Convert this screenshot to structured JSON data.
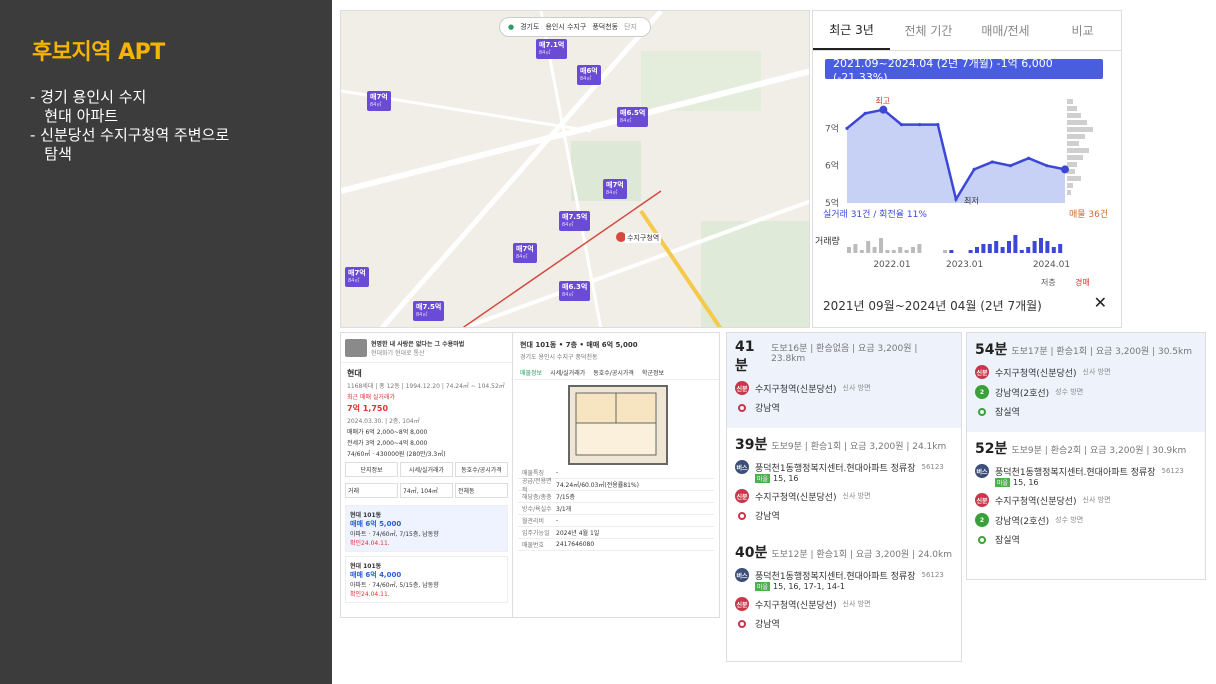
{
  "left": {
    "title": "후보지역 APT",
    "bullets": [
      "- 경기 용인시 수지\n   현대 아파트",
      "- 신분당선 수지구청역 주변으로\n   탐색"
    ]
  },
  "map": {
    "search": {
      "region": "경기도",
      "district": "용인시 수지구",
      "dong": "풍덕천동",
      "unit": "단지"
    },
    "pins": [
      {
        "price": "매7.1억",
        "sub": "84㎡"
      },
      {
        "price": "매6억",
        "sub": "84㎡"
      },
      {
        "price": "매7억",
        "sub": "84㎡"
      },
      {
        "price": "매6.5억",
        "sub": "84㎡"
      },
      {
        "price": "매7억",
        "sub": "84㎡"
      },
      {
        "price": "매7.5억",
        "sub": "84㎡"
      },
      {
        "price": "매7억",
        "sub": "84㎡"
      },
      {
        "price": "매6.3억",
        "sub": "84㎡"
      },
      {
        "price": "매7억",
        "sub": "84㎡"
      },
      {
        "price": "매7.5억",
        "sub": "84㎡"
      }
    ],
    "station_label": "수지구청역"
  },
  "chart": {
    "tabs": [
      "최근 3년",
      "전체 기간",
      "매매/전세",
      "비교"
    ],
    "banner": "2021.09~2024.04 (2년 7개월) -1억 6,000 (-21.33%)",
    "legend_trade": "실거래 31건 / 회전율 11%",
    "listing_count": "매물 36건",
    "volume_label": "거래량",
    "high_label": "최고",
    "low_label": "최저",
    "legend_low": "저층",
    "legend_auction": "경매",
    "range": "2021년 09월~2024년 04월 (2년 7개월)",
    "close": "✕"
  },
  "chart_data": {
    "type": "line",
    "title": "",
    "x": [
      "2021.09",
      "2021.12",
      "2022.01",
      "2022.06",
      "2022.09",
      "2022.12",
      "2023.01",
      "2023.03",
      "2023.06",
      "2023.09",
      "2023.12",
      "2024.01",
      "2024.04"
    ],
    "y": [
      7.0,
      7.4,
      7.5,
      7.1,
      7.1,
      7.1,
      5.1,
      5.9,
      6.1,
      6.0,
      6.2,
      6.0,
      5.9
    ],
    "xticks": [
      "2022.01",
      "2023.01",
      "2024.01"
    ],
    "yticks": [
      "5억",
      "6억",
      "7억"
    ],
    "ylim": [
      5,
      8
    ],
    "xlabel": "",
    "ylabel": ""
  },
  "listing": {
    "ad_text": "현명한 내 사랑은 없다는 그 수용마법",
    "ad_sub": "현대화기 현대로 통산",
    "apt_name": "현대",
    "apt_info": "1168세대 | 총 12동 | 1994.12.20 | 74.24㎡ ~ 104.52㎡",
    "recent_label": "최근 매매 실거래가",
    "recent_price": "7억 1,750",
    "recent_date": "2024.03.30. | 2층, 104㎡",
    "sale_range": "매매가 6억 2,000~8억 8,000",
    "jeonse_range": "전세가 3억 2,000~4억 8,000",
    "area": "74/60㎡ · 430000원 (280만/3.3㎡)",
    "buttons": [
      "단지정보",
      "시세/실거래가",
      "동호수/공시가격"
    ],
    "filters": [
      "거래",
      "74㎡, 104㎡",
      "전체동"
    ],
    "cards": [
      {
        "name": "현대 101동",
        "price": "매매 6억 5,000",
        "desc": "아파트 · 74/60㎡, 7/15층, 남동향",
        "date": "확인24.04.11."
      },
      {
        "name": "현대 101동",
        "price": "매매 6억 4,000",
        "desc": "아파트 · 74/60㎡, 5/15층, 남동향",
        "date": "확인24.04.11."
      }
    ],
    "detail_title": "현대 101동 • 7층 • 매매 6억 5,000",
    "detail_addr": "경기도 용인시 수지구 풍덕천동",
    "detail_tabs": [
      "매물정보",
      "시세/실거래가",
      "동호수/공시가격",
      "학군정보"
    ],
    "rows": [
      {
        "k": "매물특징",
        "v": "-"
      },
      {
        "k": "공급/전용면적",
        "v": "74.24㎡/60.03㎡(전용률81%)"
      },
      {
        "k": "해당층/총층",
        "v": "7/15층"
      },
      {
        "k": "방수/욕실수",
        "v": "3/1개"
      },
      {
        "k": "월관리비",
        "v": "-"
      },
      {
        "k": "입주가능일",
        "v": "2024년 4월 1일"
      },
      {
        "k": "매물번호",
        "v": "2417646080"
      }
    ]
  },
  "routes_a": [
    {
      "min": "41분",
      "meta": "도보16분 | 환승없음 | 요금 3,200원 | 23.8km",
      "stops": [
        {
          "kind": "red",
          "badge": "신분",
          "name": "수지구청역(신분당선)",
          "sub": "신사 방면"
        },
        {
          "kind": "end-red",
          "name": "강남역"
        }
      ]
    },
    {
      "min": "39분",
      "meta": "도보9분 | 환승1회 | 요금 3,200원 | 24.1km",
      "stops": [
        {
          "kind": "bus",
          "badge": "버스",
          "name": "풍덕천1동행정복지센터.현대아파트 정류장",
          "sub": "56123",
          "lines": "15, 16"
        },
        {
          "kind": "red",
          "badge": "신분",
          "name": "수지구청역(신분당선)",
          "sub": "신사 방면"
        },
        {
          "kind": "end-red",
          "name": "강남역"
        }
      ]
    },
    {
      "min": "40분",
      "meta": "도보12분 | 환승1회 | 요금 3,200원 | 24.0km",
      "stops": [
        {
          "kind": "bus",
          "badge": "버스",
          "name": "풍덕천1동행정복지센터.현대아파트 정류장",
          "sub": "56123",
          "lines": "15, 16, 17-1, 14-1"
        },
        {
          "kind": "red",
          "badge": "신분",
          "name": "수지구청역(신분당선)",
          "sub": "신사 방면"
        },
        {
          "kind": "end-red",
          "name": "강남역"
        }
      ]
    }
  ],
  "routes_b": [
    {
      "min": "54분",
      "meta": "도보17분 | 환승1회 | 요금 3,200원 | 30.5km",
      "stops": [
        {
          "kind": "red",
          "badge": "신분",
          "name": "수지구청역(신분당선)",
          "sub": "신사 방면"
        },
        {
          "kind": "green",
          "badge": "2",
          "name": "강남역(2호선)",
          "sub": "성수 방면"
        },
        {
          "kind": "end-green",
          "name": "잠실역"
        }
      ]
    },
    {
      "min": "52분",
      "meta": "도보9분 | 환승2회 | 요금 3,200원 | 30.9km",
      "stops": [
        {
          "kind": "bus",
          "badge": "버스",
          "name": "풍덕천1동행정복지센터.현대아파트 정류장",
          "sub": "56123",
          "lines": "15, 16"
        },
        {
          "kind": "red",
          "badge": "신분",
          "name": "수지구청역(신분당선)",
          "sub": "신사 방면"
        },
        {
          "kind": "green",
          "badge": "2",
          "name": "강남역(2호선)",
          "sub": "성수 방면"
        },
        {
          "kind": "end-green",
          "name": "잠실역"
        }
      ]
    }
  ]
}
